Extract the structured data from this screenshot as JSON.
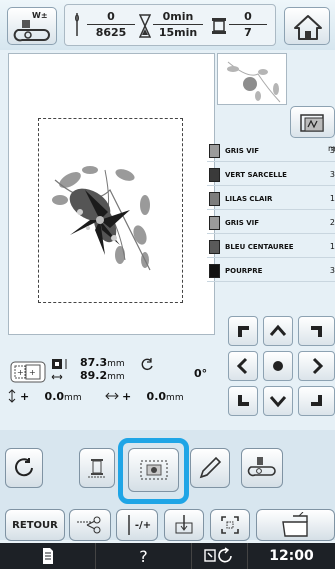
{
  "topbar": {
    "stitch_count": "0",
    "stitch_total": "8625",
    "time_elapsed": "0min",
    "time_total": "15min",
    "color_current": "0",
    "color_total": "7"
  },
  "threads": {
    "unit": "m",
    "items": [
      {
        "name": "GRIS VIF",
        "minutes": "3",
        "color": "#9b9b9b"
      },
      {
        "name": "VERT SARCELLE",
        "minutes": "3",
        "color": "#3a3a3a"
      },
      {
        "name": "LILAS CLAIR",
        "minutes": "1",
        "color": "#7d7d7d"
      },
      {
        "name": "GRIS VIF",
        "minutes": "2",
        "color": "#9b9b9b"
      },
      {
        "name": "BLEU CENTAUREE",
        "minutes": "1",
        "color": "#5a5a5a"
      },
      {
        "name": "POURPRE",
        "minutes": "3",
        "color": "#111111"
      }
    ]
  },
  "info": {
    "width": "87.3",
    "height": "89.2",
    "unit": "mm",
    "angle": "0°",
    "pos_v": "0.0",
    "pos_h": "0.0",
    "plus": "+"
  },
  "bottom": {
    "retour_label": "RETOUR",
    "needle_plus_label": "-/+"
  },
  "statusbar": {
    "help": "?",
    "clock": "12:00"
  },
  "colors": {
    "highlight": "#1fa5e6",
    "status_bg": "#1d2126"
  }
}
